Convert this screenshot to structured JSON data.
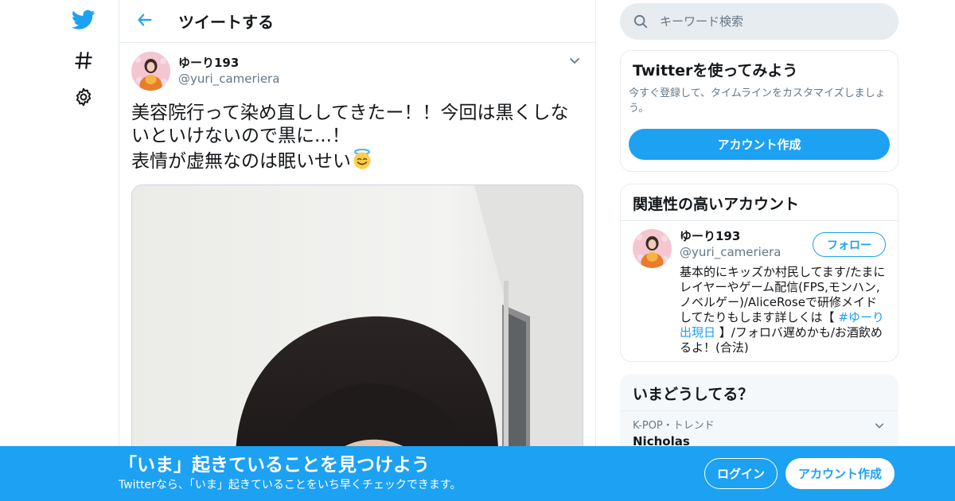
{
  "colors": {
    "brand": "#1da1f2",
    "text": "#14171a",
    "secondary_text": "#657786",
    "border": "#e6ecf0"
  },
  "nav": {
    "items": [
      {
        "icon": "twitter-bird-icon"
      },
      {
        "icon": "hashtag-icon"
      },
      {
        "icon": "gear-icon"
      }
    ]
  },
  "header": {
    "back_icon": "arrow-left-icon",
    "title": "ツイートする"
  },
  "tweet": {
    "author_name": "ゆーり193",
    "author_handle": "@yuri_cameriera",
    "text_line1": "美容院行って染め直ししてきたー！！今回は黒くしな",
    "text_line2": "いといけないので黒に...！",
    "text_line3": "表情が虚無なのは眠いせい",
    "emoji": "smiling-face-with-halo"
  },
  "search": {
    "placeholder": "キーワード検索"
  },
  "signup_card": {
    "title": "Twitterを使ってみよう",
    "description": "今すぐ登録して、タイムラインをカスタマイズしましょう。",
    "button": "アカウント作成"
  },
  "related": {
    "title": "関連性の高いアカウント",
    "account": {
      "name": "ゆーり193",
      "handle": "@yuri_cameriera",
      "follow_label": "フォロー",
      "bio_part1": "基本的にキッズか村民してます/たまにレイヤーやゲーム配信(FPS,モンハン,ノベルゲー)/AliceRoseで研修メイドしてたりもします詳しくは【 ",
      "bio_hashtag": "#ゆーり出現日",
      "bio_part2": " 】/フォロバ遅めかも/お酒飲めるよ！(合法)"
    }
  },
  "trends": {
    "title": "いまどうしてる？",
    "items": [
      {
        "meta": "K-POP・トレンド",
        "name": "Nicholas"
      }
    ]
  },
  "banner": {
    "title": "「いま」起きていることを見つけよう",
    "subtitle": "Twitterなら、「いま」起きていることをいち早くチェックできます。",
    "login": "ログイン",
    "signup": "アカウント作成"
  }
}
